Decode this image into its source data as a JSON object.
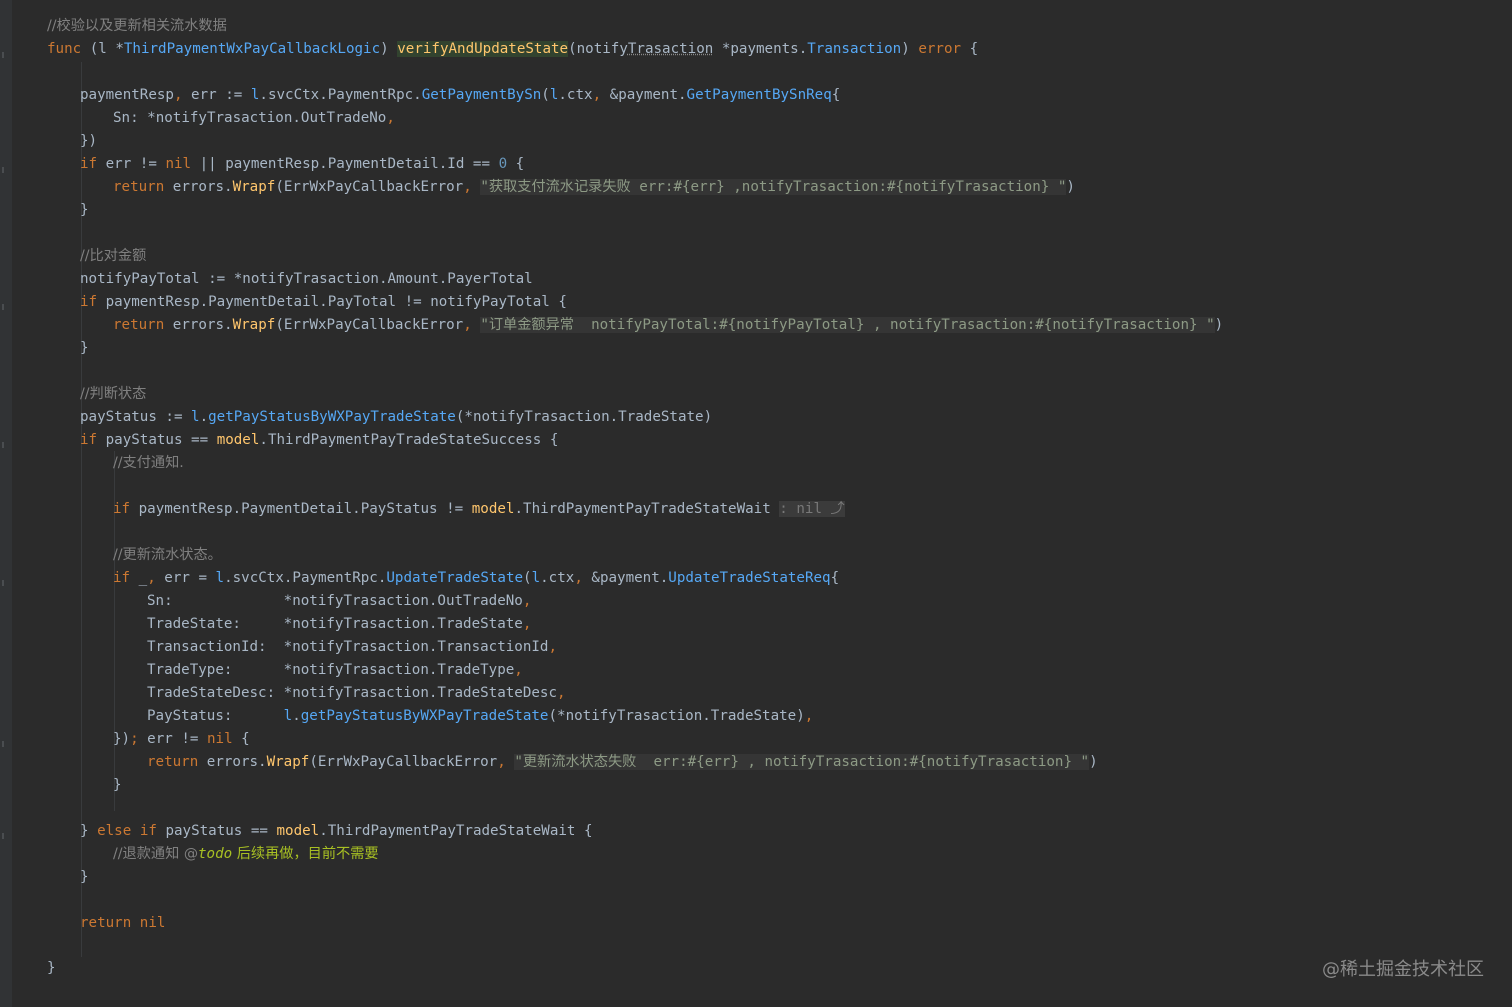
{
  "code": {
    "l1_comment": "//校验以及更新相关流水数据",
    "l2_func_kw": "func",
    "l2_recv_open": " (l *",
    "l2_recv_type": "ThirdPaymentWxPayCallbackLogic",
    "l2_recv_close": ") ",
    "l2_func_name": "verifyAndUpdateState",
    "l2_param_open": "(notify",
    "l2_param_u": "Trasaction",
    "l2_param_type_a": " *payments.",
    "l2_param_type_b": "Transaction",
    "l2_param_close": ") ",
    "l2_ret": "error",
    "l2_brace": " {",
    "l4_a": "paymentResp",
    "l4_comma1": ",",
    "l4_b": " err := ",
    "l4_l": "l",
    "l4_c": ".svcCtx.PaymentRpc.",
    "l4_call": "GetPaymentBySn",
    "l4_d": "(",
    "l4_l2": "l",
    "l4_e": ".ctx",
    "l4_comma2": ",",
    "l4_f": " &payment.",
    "l4_type": "GetPaymentBySnReq",
    "l4_g": "{",
    "l5_a": "Sn: *notifyTrasaction.OutTradeNo",
    "l5_comma": ",",
    "l6": "})",
    "l7_if": "if",
    "l7_a": " err != ",
    "l7_nil": "nil",
    "l7_b": " || paymentResp.PaymentDetail.Id == ",
    "l7_num": "0",
    "l7_c": " {",
    "l8_ret": "return",
    "l8_a": " errors.",
    "l8_call": "Wrapf",
    "l8_b": "(ErrWxPayCallbackError",
    "l8_comma": ",",
    "l8_sp": " ",
    "l8_str": "\"获取支付流水记录失败 err:#{err} ,notifyTrasaction:#{notifyTrasaction} \"",
    "l8_c": ")",
    "l9": "}",
    "l11_comment": "//比对金额",
    "l12": "notifyPayTotal := *notifyTrasaction.Amount.PayerTotal",
    "l13_if": "if",
    "l13_a": " paymentResp.PaymentDetail.PayTotal != notifyPayTotal {",
    "l14_ret": "return",
    "l14_a": " errors.",
    "l14_call": "Wrapf",
    "l14_b": "(ErrWxPayCallbackError",
    "l14_comma": ",",
    "l14_sp": " ",
    "l14_str": "\"订单金额异常  notifyPayTotal:#{notifyPayTotal} , notifyTrasaction:#{notifyTrasaction} \"",
    "l14_c": ")",
    "l15": "}",
    "l17_comment": "//判断状态",
    "l18_a": "payStatus := ",
    "l18_l": "l",
    "l18_b": ".",
    "l18_call": "getPayStatusByWXPayTradeState",
    "l18_c": "(*notifyTrasaction.TradeState)",
    "l19_if": "if",
    "l19_a": " payStatus == ",
    "l19_model": "model",
    "l19_b": ".ThirdPaymentPayTradeStateSuccess {",
    "l20_comment": "//支付通知.",
    "l22_if": "if",
    "l22_a": " paymentResp.PaymentDetail.PayStatus != ",
    "l22_model": "model",
    "l22_b": ".ThirdPaymentPayTradeStateWait",
    "l22_sp": " ",
    "l22_hint": ": nil ⤴",
    "l24_comment": "//更新流水状态。",
    "l25_if": "if",
    "l25_a": " _",
    "l25_comma1": ",",
    "l25_b": " err = ",
    "l25_l": "l",
    "l25_c": ".svcCtx.PaymentRpc.",
    "l25_call": "UpdateTradeState",
    "l25_d": "(",
    "l25_l2": "l",
    "l25_e": ".ctx",
    "l25_comma2": ",",
    "l25_f": " &payment.",
    "l25_type": "UpdateTradeStateReq",
    "l25_g": "{",
    "l26_a": "Sn:             *notifyTrasaction.OutTradeNo",
    "l26_comma": ",",
    "l27_a": "TradeState:     *notifyTrasaction.TradeState",
    "l27_comma": ",",
    "l28_a": "TransactionId:  *notifyTrasaction.TransactionId",
    "l28_comma": ",",
    "l29_a": "TradeType:      *notifyTrasaction.TradeType",
    "l29_comma": ",",
    "l30_a": "TradeStateDesc: *notifyTrasaction.TradeStateDesc",
    "l30_comma": ",",
    "l31_a": "PayStatus:      ",
    "l31_l": "l",
    "l31_b": ".",
    "l31_call": "getPayStatusByWXPayTradeState",
    "l31_c": "(*notifyTrasaction.TradeState)",
    "l31_comma": ",",
    "l32_a": "})",
    "l32_semi": ";",
    "l32_b": " err != ",
    "l32_nil": "nil",
    "l32_c": " {",
    "l33_ret": "return",
    "l33_a": " errors.",
    "l33_call": "Wrapf",
    "l33_b": "(ErrWxPayCallbackError",
    "l33_comma": ",",
    "l33_sp": " ",
    "l33_str": "\"更新流水状态失败  err:#{err} , notifyTrasaction:#{notifyTrasaction} \"",
    "l33_c": ")",
    "l34": "}",
    "l36_a": "} ",
    "l36_else": "else",
    "l36_sp": " ",
    "l36_if": "if",
    "l36_b": " payStatus == ",
    "l36_model": "model",
    "l36_c": ".ThirdPaymentPayTradeStateWait {",
    "l37_comment": "//退款通知 ",
    "l37_at": "@",
    "l37_todo": "todo",
    "l37_todo_txt": " 后续再做，目前不需要",
    "l38": "}",
    "l40_ret": "return",
    "l40_sp": " ",
    "l40_nil": "nil",
    "l42": "}"
  },
  "watermark": "@稀土掘金技术社区",
  "colors": {
    "background": "#2b2b2b",
    "keyword": "#cc7832",
    "function": "#ffc66d",
    "type": "#56a8f5",
    "comment": "#808080",
    "todo": "#a8c023",
    "text": "#a9b7c6"
  }
}
